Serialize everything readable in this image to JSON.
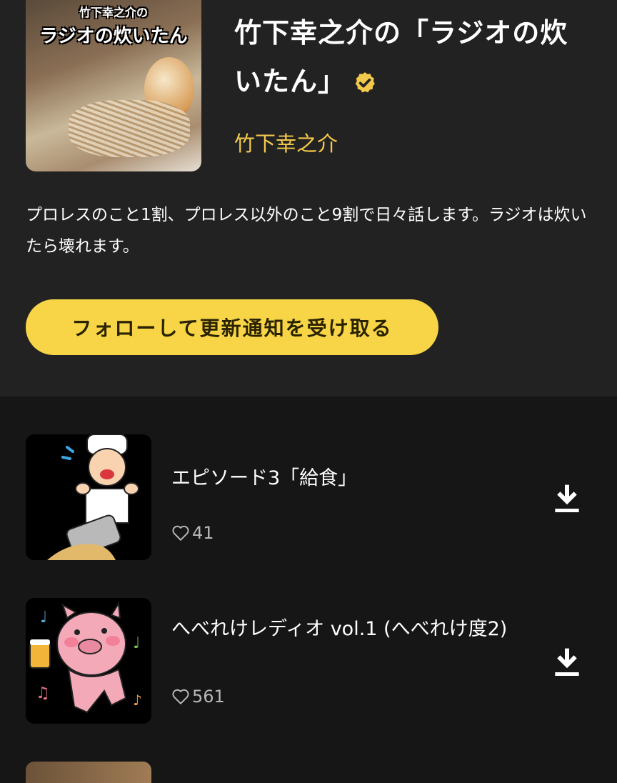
{
  "podcast": {
    "cover_text_top": "竹下幸之介の",
    "cover_text_main": "ラジオの炊いたん",
    "title": "竹下幸之介の「ラジオの炊いたん」",
    "author": "竹下幸之介",
    "description": "プロレスのこと1割、プロレス以外のこと9割で日々話します。ラジオは炊いたら壊れます。",
    "follow_label": "フォローして更新通知を受け取る",
    "accent_color": "#f7d547"
  },
  "episodes": [
    {
      "title": "エピソード3「給食」",
      "likes": "41",
      "thumb_icon": "chef-spilling-pot-illustration",
      "action_icon": "download-icon"
    },
    {
      "title": "へべれけレディオ vol.1 (へべれけ度2)",
      "likes": "561",
      "thumb_icon": "dancing-pig-with-beer-illustration",
      "action_icon": "download-icon"
    }
  ]
}
